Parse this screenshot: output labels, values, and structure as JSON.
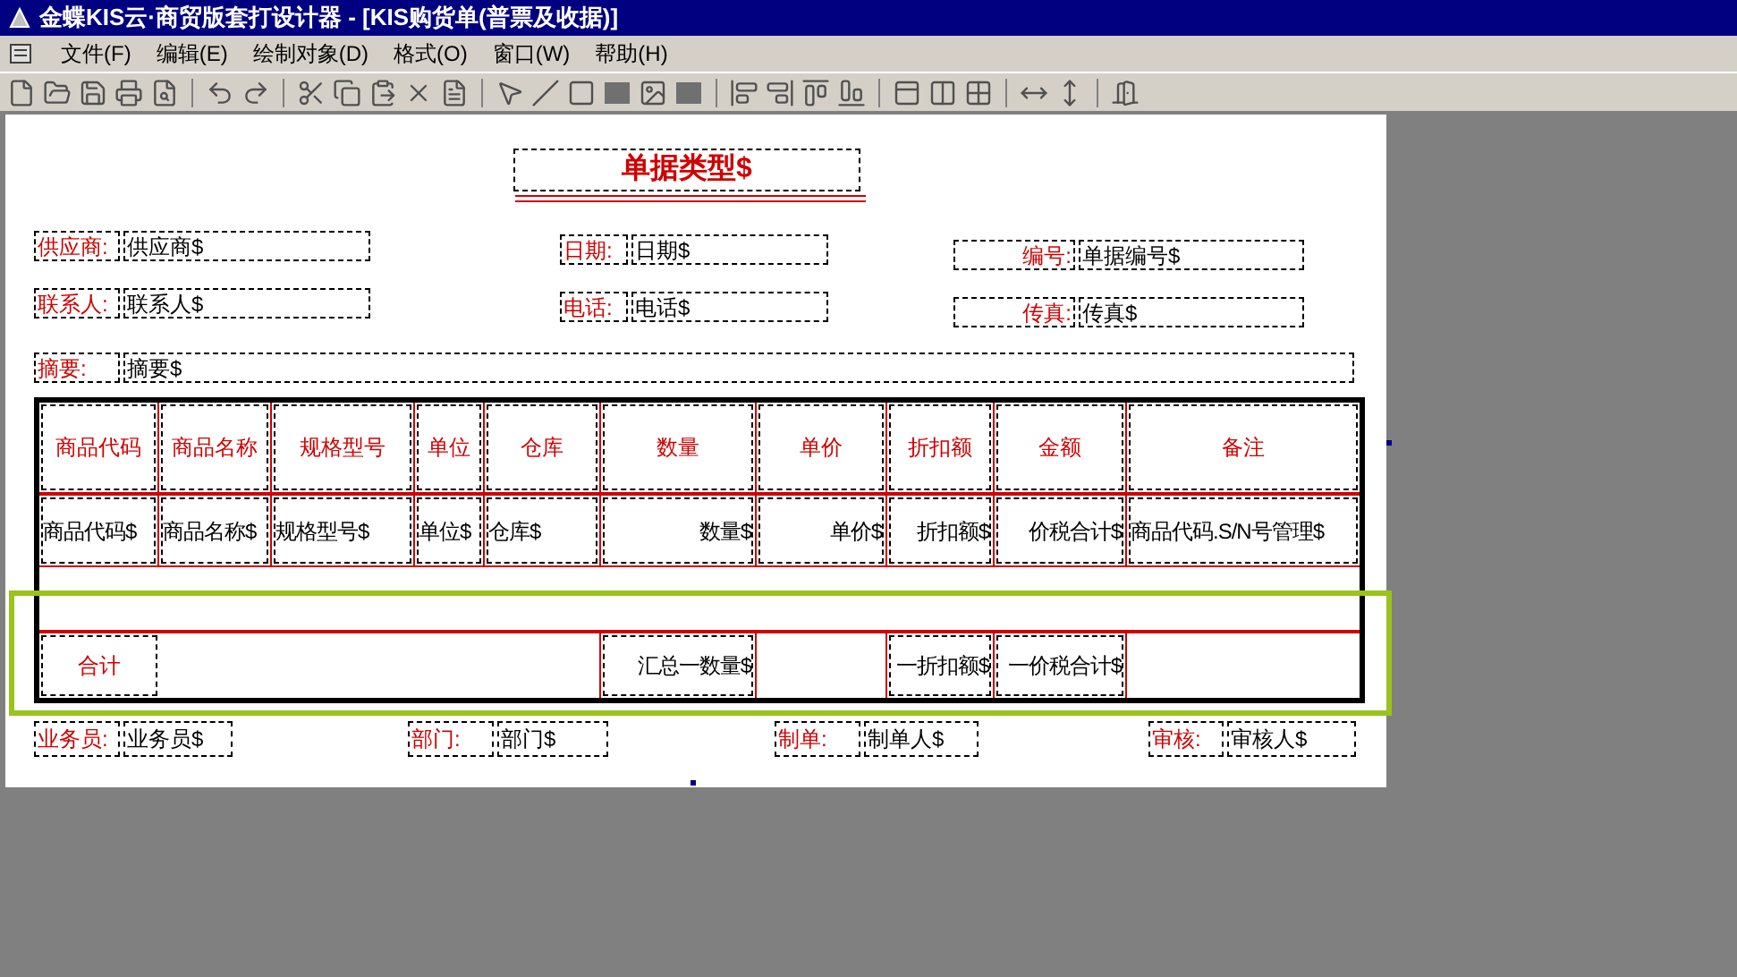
{
  "window": {
    "title": "金蝶KIS云·商贸版套打设计器 - [KIS购货单(普票及收据)]"
  },
  "menu": [
    {
      "label": "文件(F)"
    },
    {
      "label": "编辑(E)"
    },
    {
      "label": "绘制对象(D)"
    },
    {
      "label": "格式(O)"
    },
    {
      "label": "窗口(W)"
    },
    {
      "label": "帮助(H)"
    }
  ],
  "report": {
    "title": "单据类型$",
    "header_fields": [
      {
        "label": "供应商:",
        "value": "供应商$"
      },
      {
        "label": "日期:",
        "value": "日期$"
      },
      {
        "label": "编号:",
        "value": "单据编号$"
      },
      {
        "label": "联系人:",
        "value": "联系人$"
      },
      {
        "label": "电话:",
        "value": "电话$"
      },
      {
        "label": "传真:",
        "value": "传真$"
      },
      {
        "label": "摘要:",
        "value": "摘要$"
      }
    ],
    "table": {
      "columns": [
        "商品代码",
        "商品名称",
        "规格型号",
        "单位",
        "仓库",
        "数量",
        "单价",
        "折扣额",
        "金额",
        "备注"
      ],
      "row": [
        "商品代码$",
        "商品名称$",
        "规格型号$",
        "单位$",
        "仓库$",
        "数量$",
        "单价$",
        "折扣额$",
        "价税合计$",
        "商品代码.S/N号管理$"
      ],
      "totals": [
        {
          "kind": "label",
          "text": "合计"
        },
        {
          "kind": "blank"
        },
        {
          "kind": "blank"
        },
        {
          "kind": "blank"
        },
        {
          "kind": "blank"
        },
        {
          "kind": "value",
          "text": "汇总一数量$"
        },
        {
          "kind": "blank"
        },
        {
          "kind": "value",
          "text": "一折扣额$"
        },
        {
          "kind": "value",
          "text": "一价税合计$"
        },
        {
          "kind": "blank"
        }
      ]
    },
    "footer_fields": [
      {
        "label": "业务员:",
        "value": "业务员$"
      },
      {
        "label": "部门:",
        "value": "部门$"
      },
      {
        "label": "制单:",
        "value": "制单人$"
      },
      {
        "label": "审核:",
        "value": "审核人$"
      }
    ]
  }
}
